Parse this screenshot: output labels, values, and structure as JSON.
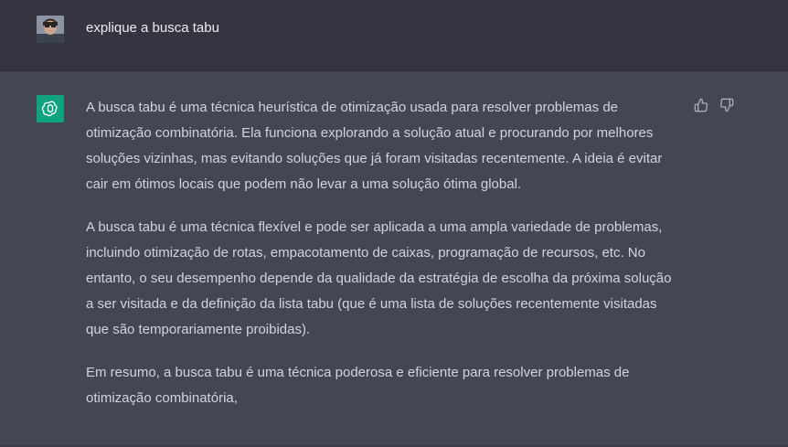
{
  "user_message": {
    "text": "explique a busca tabu"
  },
  "assistant_message": {
    "paragraphs": [
      "A busca tabu é uma técnica heurística de otimização usada para resolver problemas de otimização combinatória. Ela funciona explorando a solução atual e procurando por melhores soluções vizinhas, mas evitando soluções que já foram visitadas recentemente. A ideia é evitar cair em ótimos locais que podem não levar a uma solução ótima global.",
      "A busca tabu é uma técnica flexível e pode ser aplicada a uma ampla variedade de problemas, incluindo otimização de rotas, empacotamento de caixas, programação de recursos, etc. No entanto, o seu desempenho depende da qualidade da estratégia de escolha da próxima solução a ser visitada e da definição da lista tabu (que é uma lista de soluções recentemente visitadas que são temporariamente proibidas).",
      "Em resumo, a busca tabu é uma técnica poderosa e eficiente para resolver problemas de otimização combinatória,"
    ]
  },
  "icons": {
    "assistant_avatar": "openai-logo-icon",
    "thumbs_up": "thumbs-up-icon",
    "thumbs_down": "thumbs-down-icon"
  },
  "colors": {
    "user_row_bg": "#343541",
    "assistant_row_bg": "#444654",
    "assistant_avatar_bg": "#10a37f"
  }
}
